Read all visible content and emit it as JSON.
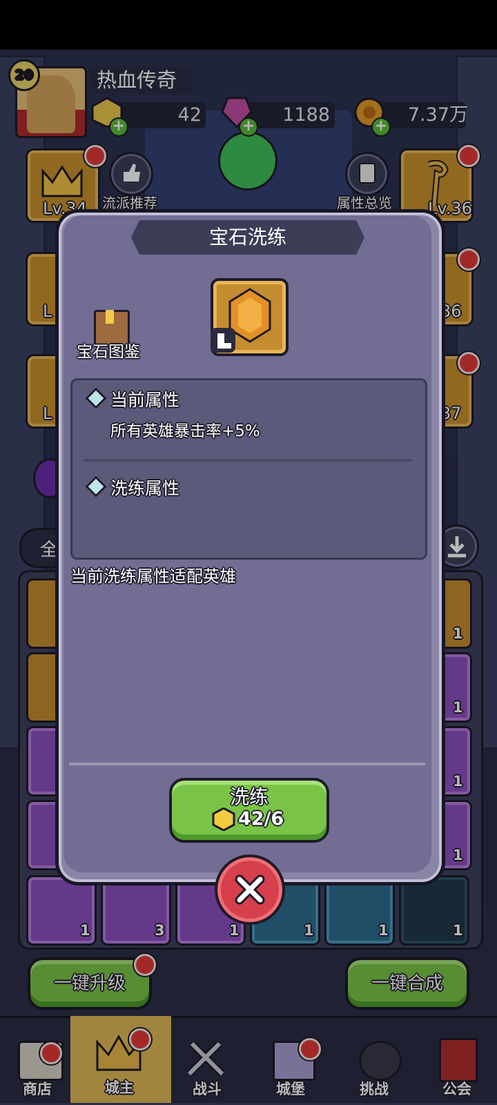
{
  "player": {
    "name": "热血传奇",
    "level": "20"
  },
  "resources": {
    "gold_gem": "42",
    "purple_gem": "1188",
    "coins": "7.37万"
  },
  "side_buttons": {
    "left_top_level": "Lv.34",
    "left_mid_level": "L",
    "left_low_level": "L",
    "right_top_level": "Lv.36",
    "right_mid_level": "36",
    "right_low_level": "37",
    "recommend": "流派推荐",
    "attr_overview": "属性总览"
  },
  "filter_tab": "全",
  "inventory": {
    "row_counts": [
      "1",
      "1",
      "1",
      "1"
    ],
    "bottom_counts": [
      "1",
      "3",
      "1",
      "1",
      "1",
      "1"
    ]
  },
  "bottom_buttons": {
    "upgrade_all": "一键升级",
    "compose_all": "一键合成"
  },
  "nav": [
    {
      "label": "商店"
    },
    {
      "label": "城主"
    },
    {
      "label": "战斗"
    },
    {
      "label": "城堡"
    },
    {
      "label": "挑战"
    },
    {
      "label": "公会"
    }
  ],
  "dialog": {
    "title": "宝石洗练",
    "codex_label": "宝石图鉴",
    "current_attr_heading": "当前属性",
    "current_attr_value": "所有英雄暴击率+5%",
    "refine_attr_heading": "洗练属性",
    "refine_attr_value": "",
    "hero_match_text": "当前洗练属性适配英雄",
    "refine_button_label": "洗练",
    "refine_cost": "42/6"
  },
  "colors": {
    "accent_green": "#79c447",
    "close_red": "#d63f4c",
    "dialog_bg": "#716d93",
    "gold": "#c8912d"
  }
}
